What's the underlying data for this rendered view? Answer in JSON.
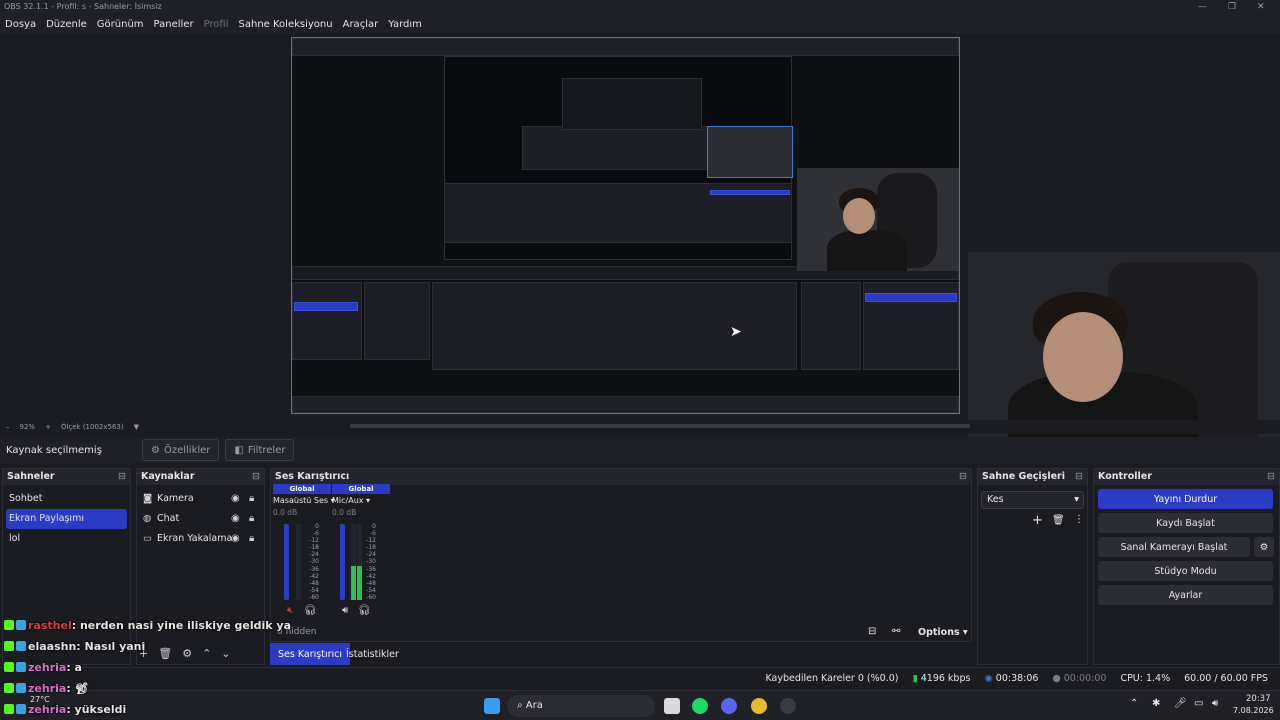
{
  "window": {
    "title": "OBS 32.1.1 - Profil: s - Sahneler: İsimsiz"
  },
  "menu": {
    "items": [
      "Dosya",
      "Düzenle",
      "Görünüm",
      "Paneller",
      "Profil",
      "Sahne Koleksiyonu",
      "Araçlar",
      "Yardım"
    ],
    "disabled": [
      "Profil"
    ]
  },
  "zoom": {
    "minus": "–",
    "value": "92%",
    "plus": "+",
    "fit": "Ölçek (1002x563)"
  },
  "props": {
    "no_source": "Kaynak seçilmemiş",
    "properties": "Özellikler",
    "filters": "Filtreler"
  },
  "scenes": {
    "title": "Sahneler",
    "items": [
      "Sohbet",
      "Ekran Paylaşımı",
      "lol"
    ],
    "selected": 1
  },
  "sources": {
    "title": "Kaynaklar",
    "items": [
      {
        "name": "Kamera",
        "icon": "camera-icon"
      },
      {
        "name": "Chat",
        "icon": "globe-icon"
      },
      {
        "name": "Ekran Yakalama",
        "icon": "monitor-icon"
      }
    ]
  },
  "mixer": {
    "title": "Ses Karıştırıcı",
    "channels": [
      {
        "badge": "Global",
        "name": "Masaüstü Ses",
        "db": "0.0 dB",
        "level": 0.0
      },
      {
        "badge": "Global",
        "name": "Mic/Aux",
        "db": "0.0 dB",
        "level": 0.45
      }
    ],
    "scale": [
      "0",
      "-6",
      "-12",
      "-18",
      "-24",
      "-30",
      "-36",
      "-42",
      "-48",
      "-54",
      "-60"
    ],
    "hidden": "0 hidden",
    "options": "Options",
    "tabs": [
      "Ses Karıştırıcı",
      "İstatistikler"
    ]
  },
  "transitions": {
    "title": "Sahne Geçişleri",
    "selected": "Kes"
  },
  "controls": {
    "title": "Kontroller",
    "stop_stream": "Yayını Durdur",
    "start_record": "Kaydı Başlat",
    "virtual_cam": "Sanal Kamerayı Başlat",
    "studio": "Stüdyo Modu",
    "settings": "Ayarlar"
  },
  "status": {
    "dropped": "Kaybedilen Kareler 0 (%0.0)",
    "bitrate": "4196 kbps",
    "stream_time": "00:38:06",
    "rec_time": "00:00:00",
    "cpu": "CPU: 1.4%",
    "fps": "60.00 / 60.00 FPS"
  },
  "chat": [
    {
      "user": "rasthel",
      "msg": ": nerden nasi yine iliskiye geldik ya",
      "color": "#e23b3b"
    },
    {
      "user": "elaashn",
      "msg": ": Nasıl yani",
      "color": "#e6e6e6"
    },
    {
      "user": "zehria",
      "msg": ": a",
      "color": "#d86fd0"
    },
    {
      "user": "zehria",
      "msg": ": ",
      "color": "#d86fd0"
    },
    {
      "user": "zehria",
      "msg": ": yükseldi",
      "color": "#d86fd0"
    }
  ],
  "taskbar": {
    "search": "Ara",
    "time": "20:37",
    "date": "7.08.2026",
    "weather": "27°C"
  },
  "colors": {
    "accent": "#2a3cc6",
    "meter": "#2fbf4a",
    "bg": "#1b1c22"
  }
}
